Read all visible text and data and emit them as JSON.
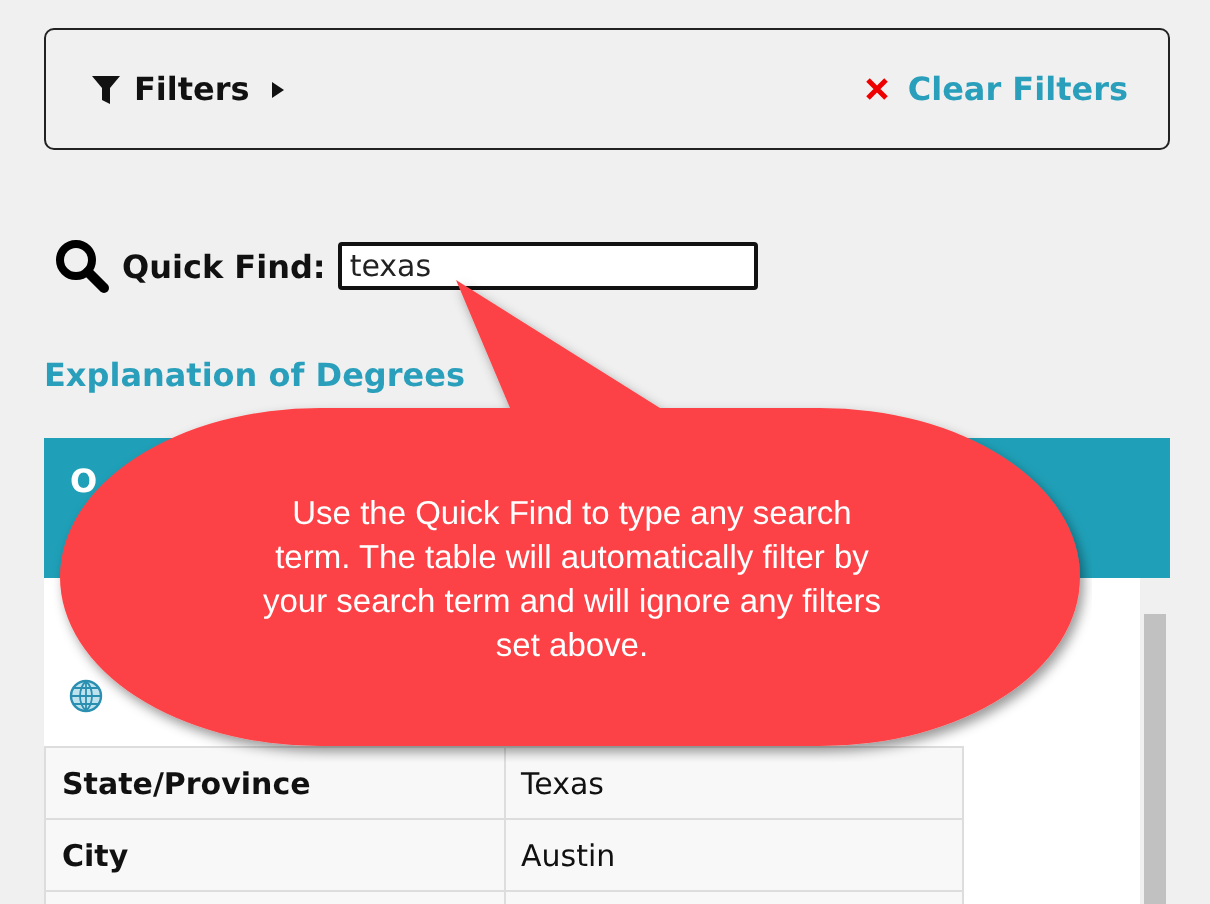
{
  "filters": {
    "label": "Filters",
    "expanded": false,
    "clear_label": "Clear Filters"
  },
  "quick_find": {
    "label": "Quick Find:",
    "value": "texas"
  },
  "link": "Explanation of Degrees",
  "table": {
    "header": "O",
    "rows": [
      {
        "label": "State/Province",
        "value": "Texas"
      },
      {
        "label": "City",
        "value": "Austin"
      }
    ]
  },
  "callout": {
    "text": "Use the Quick Find to type any search term. The table will automatically filter by your search term and will ignore any filters set above."
  }
}
